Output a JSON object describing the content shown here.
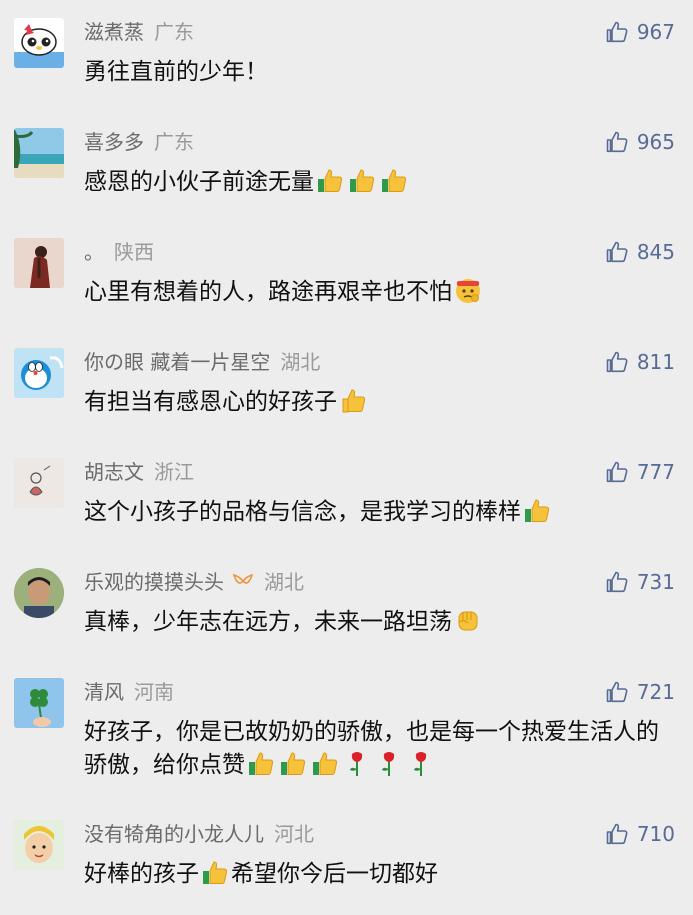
{
  "comments": [
    {
      "nickname": "滋煮蒸",
      "region": "广东",
      "likes": "967",
      "text": "勇往直前的少年！",
      "emojis": [],
      "avatar": "hello-kitty"
    },
    {
      "nickname": "喜多多",
      "region": "广东",
      "likes": "965",
      "text": "感恩的小伙子前途无量",
      "emojis": [
        "thumbs-up",
        "thumbs-up",
        "thumbs-up"
      ],
      "avatar": "beach"
    },
    {
      "nickname": "。",
      "region": "陕西",
      "likes": "845",
      "text": "心里有想着的人，路途再艰辛也不怕",
      "emojis": [
        "determined-face"
      ],
      "avatar": "girl"
    },
    {
      "nickname": "你の眼 藏着一片星空",
      "region": "湖北",
      "likes": "811",
      "text": "有担当有感恩心的好孩子",
      "emojis": [
        "thumbs-up"
      ],
      "avatar": "doraemon"
    },
    {
      "nickname": "胡志文",
      "region": "浙江",
      "likes": "777",
      "text": "这个小孩子的品格与信念，是我学习的棒样",
      "emojis": [
        "thumbs-up"
      ],
      "avatar": "sketch"
    },
    {
      "nickname": "乐观的摸摸头头",
      "region": "湖北",
      "likes": "731",
      "text": "真棒，少年志在远方，未来一路坦荡",
      "emojis": [
        "fist"
      ],
      "avatar": "boy",
      "badge": "orange-ribbon"
    },
    {
      "nickname": "清风",
      "region": "河南",
      "likes": "721",
      "text": "好孩子，你是已故奶奶的骄傲，也是每一个热爱生活人的骄傲，给你点赞",
      "emojis": [
        "thumbs-up",
        "thumbs-up",
        "thumbs-up",
        "rose",
        "rose",
        "rose"
      ],
      "avatar": "clover"
    },
    {
      "nickname": "没有犄角的小龙人儿",
      "region": "河北",
      "likes": "710",
      "text": "好棒的孩子",
      "text2": "希望你今后一切都好",
      "emojis": [
        "thumbs-up"
      ],
      "avatar": "baby"
    }
  ],
  "colors": {
    "like": "#576b95",
    "nickname": "#6b6b6b",
    "region": "#9a9a9a",
    "background": "#ededed"
  }
}
